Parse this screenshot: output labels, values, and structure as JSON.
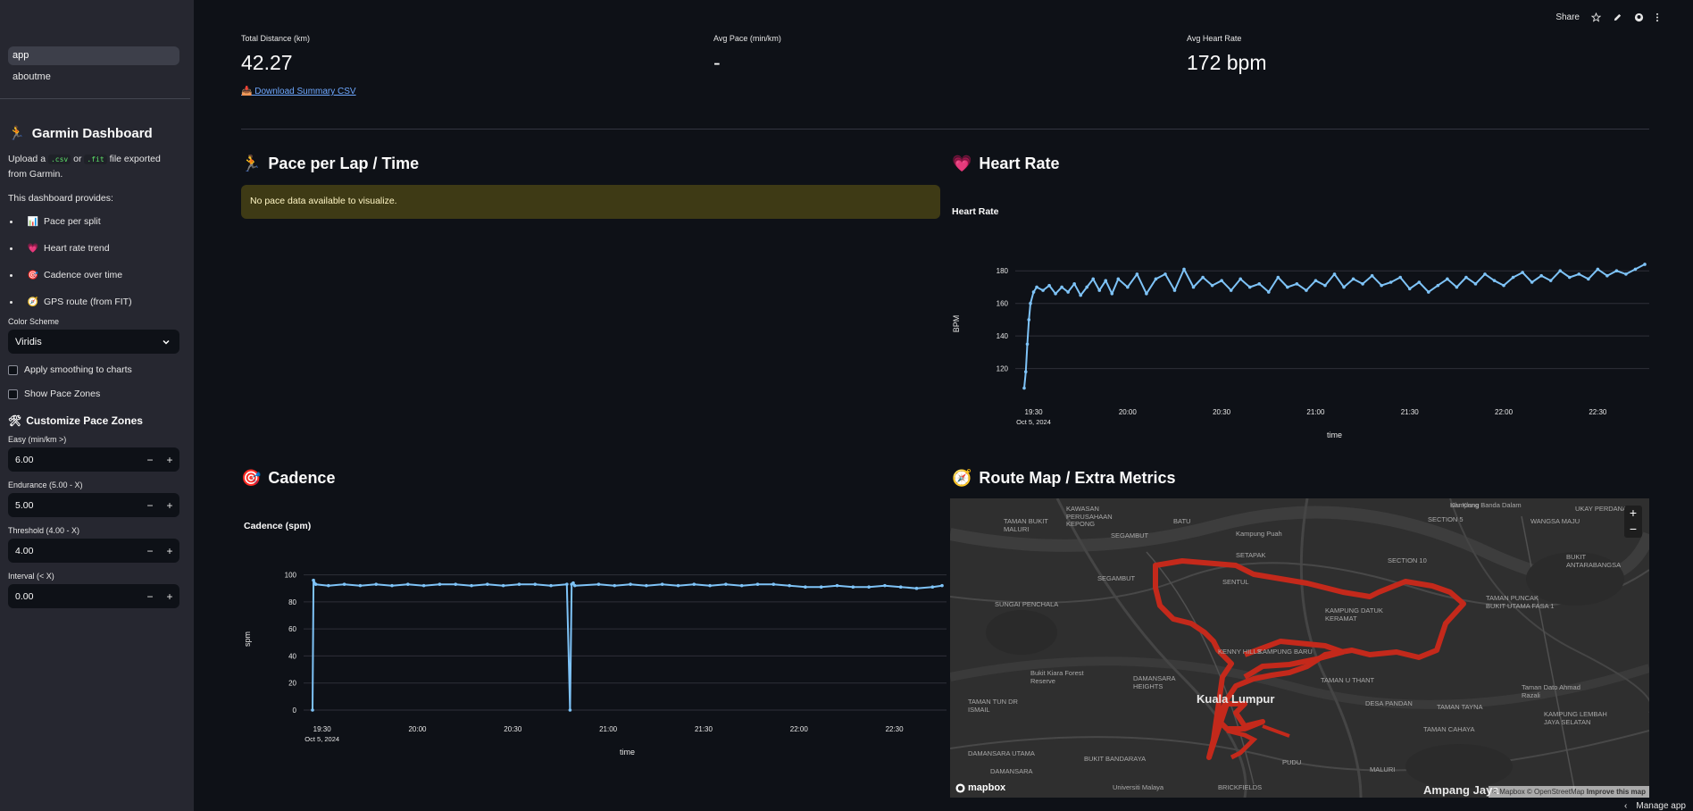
{
  "sidebar": {
    "nav": [
      "app",
      "aboutme"
    ],
    "title": "Garmin Dashboard",
    "title_icon": "running-icon",
    "intro": {
      "pre": "Upload a",
      "code1": ".csv",
      "mid": "or",
      "code2": ".fit",
      "post": "file exported from Garmin."
    },
    "provides": "This dashboard provides:",
    "features": [
      {
        "icon": "📊",
        "label": "Pace per split"
      },
      {
        "icon": "💗",
        "label": "Heart rate trend"
      },
      {
        "icon": "🎯",
        "label": "Cadence over time"
      },
      {
        "icon": "🧭",
        "label": "GPS route (from FIT)"
      }
    ],
    "color_scheme": {
      "label": "Color Scheme",
      "value": "Viridis"
    },
    "checks": [
      "Apply smoothing to charts",
      "Show Pace Zones"
    ],
    "pace_zones": {
      "title": "Customize Pace Zones",
      "inputs": [
        {
          "label": "Easy (min/km >)",
          "value": "6.00"
        },
        {
          "label": "Endurance (5.00 - X)",
          "value": "5.00"
        },
        {
          "label": "Threshold (4.00 - X)",
          "value": "4.00"
        },
        {
          "label": "Interval (< X)",
          "value": "0.00"
        }
      ]
    }
  },
  "toolbar": {
    "share": "Share"
  },
  "metrics": [
    {
      "label": "Total Distance (km)",
      "value": "42.27"
    },
    {
      "label": "Avg Pace (min/km)",
      "value": "-"
    },
    {
      "label": "Avg Heart Rate",
      "value": "172 bpm"
    }
  ],
  "download": "📥 Download Summary CSV",
  "sections": {
    "pace": {
      "title": "Pace per Lap / Time",
      "warning": "No pace data available to visualize."
    },
    "heart": {
      "title": "Heart Rate"
    },
    "cadence": {
      "title": "Cadence"
    },
    "route": {
      "title": "Route Map / Extra Metrics"
    }
  },
  "map": {
    "labels": [
      "Kampung Banda Dalam",
      "KAWASAN PERUSAHAAN KEPONG",
      "TAMAN BUKIT MALURI",
      "BATU",
      "SEGAMBUT",
      "Kampung Puah",
      "SECTION 5",
      "Ulu Klang",
      "UKAY PERDANA",
      "WANGSA MAJU",
      "SETAPAK",
      "SECTION 10",
      "BUKIT ANTARABANGSA",
      "SEGAMBUT",
      "SENTUL",
      "TAMAN PUNCAK BUKIT UTAMA FASA 1",
      "SUNGAI PENCHALA",
      "KAMPUNG DATUK KERAMAT",
      "KENNY HILLS",
      "KAMPUNG BARU",
      "Bukit Kiara Forest Reserve",
      "DAMANSARA HEIGHTS",
      "TAMAN U THANT",
      "Taman Dato Ahmad Razali",
      "TAMAN TUN DR ISMAIL",
      "Kuala Lumpur",
      "DESA PANDAN",
      "TAMAN TAYNA",
      "TAMAN CAHAYA",
      "KAMPUNG LEMBAH JAYA SELATAN",
      "DAMANSARA UTAMA",
      "BUKIT BANDARAYA",
      "PUDU",
      "MALURI",
      "Ampang Jaya",
      "BRICKFIELDS",
      "Universiti Malaya",
      "DAMANSARA"
    ],
    "attribution": "© Mapbox © OpenStreetMap",
    "improve": "Improve this map",
    "logo": "mapbox"
  },
  "manage": "Manage app",
  "chart_data": [
    {
      "type": "line",
      "title": "Heart Rate",
      "xlabel": "time",
      "ylabel": "BPM",
      "x_ticks": [
        "19:30",
        "20:00",
        "20:30",
        "21:00",
        "21:30",
        "22:00",
        "22:30"
      ],
      "x_sub": "Oct 5, 2024",
      "y_ticks": [
        120,
        140,
        160,
        180
      ],
      "ylim": [
        105,
        190
      ],
      "series": [
        {
          "color": "#7ec3f7",
          "x": [
            0,
            0.5,
            1,
            1.5,
            2,
            3,
            4,
            6,
            8,
            10,
            12,
            14,
            16,
            18,
            20,
            22,
            24,
            26,
            28,
            30,
            33,
            36,
            39,
            42,
            45,
            48,
            51,
            54,
            57,
            60,
            63,
            66,
            69,
            72,
            75,
            78,
            81,
            84,
            87,
            90,
            93,
            96,
            99,
            102,
            105,
            108,
            111,
            114,
            117,
            120,
            123,
            126,
            129,
            132,
            135,
            138,
            141,
            144,
            147,
            150,
            153,
            156,
            159,
            162,
            165,
            168,
            171,
            174,
            177,
            180,
            183,
            186,
            189,
            192,
            195,
            198
          ],
          "y": [
            108,
            118,
            135,
            150,
            160,
            167,
            170,
            168,
            171,
            166,
            170,
            167,
            172,
            165,
            170,
            175,
            168,
            174,
            166,
            175,
            170,
            178,
            166,
            175,
            178,
            168,
            181,
            170,
            176,
            171,
            174,
            168,
            175,
            170,
            172,
            167,
            176,
            170,
            172,
            168,
            174,
            171,
            178,
            170,
            175,
            172,
            177,
            171,
            173,
            176,
            169,
            173,
            167,
            171,
            175,
            170,
            176,
            172,
            178,
            174,
            171,
            176,
            179,
            173,
            177,
            174,
            180,
            176,
            178,
            175,
            181,
            177,
            180,
            178,
            181,
            184
          ]
        }
      ]
    },
    {
      "type": "line",
      "title": "Cadence (spm)",
      "xlabel": "time",
      "ylabel": "spm",
      "x_ticks": [
        "19:30",
        "20:00",
        "20:30",
        "21:00",
        "21:30",
        "22:00",
        "22:30"
      ],
      "x_sub": "Oct 5, 2024",
      "y_ticks": [
        0,
        20,
        40,
        60,
        80,
        100
      ],
      "ylim": [
        0,
        105
      ],
      "series": [
        {
          "color": "#7ec3f7",
          "x": [
            0,
            0.3,
            1,
            5,
            10,
            15,
            20,
            25,
            30,
            35,
            40,
            45,
            50,
            55,
            60,
            65,
            70,
            75,
            80,
            81,
            81.5,
            82,
            82.5,
            90,
            95,
            100,
            105,
            110,
            115,
            120,
            125,
            130,
            135,
            140,
            145,
            150,
            155,
            160,
            165,
            170,
            175,
            180,
            185,
            190,
            195,
            198
          ],
          "y": [
            0,
            96,
            93,
            92,
            93,
            92,
            93,
            92,
            93,
            92,
            93,
            93,
            92,
            93,
            92,
            93,
            93,
            92,
            93,
            0,
            93,
            94,
            92,
            93,
            92,
            93,
            92,
            93,
            92,
            93,
            92,
            93,
            92,
            93,
            93,
            92,
            91,
            91,
            92,
            91,
            91,
            92,
            91,
            90,
            91,
            92
          ]
        }
      ]
    }
  ]
}
